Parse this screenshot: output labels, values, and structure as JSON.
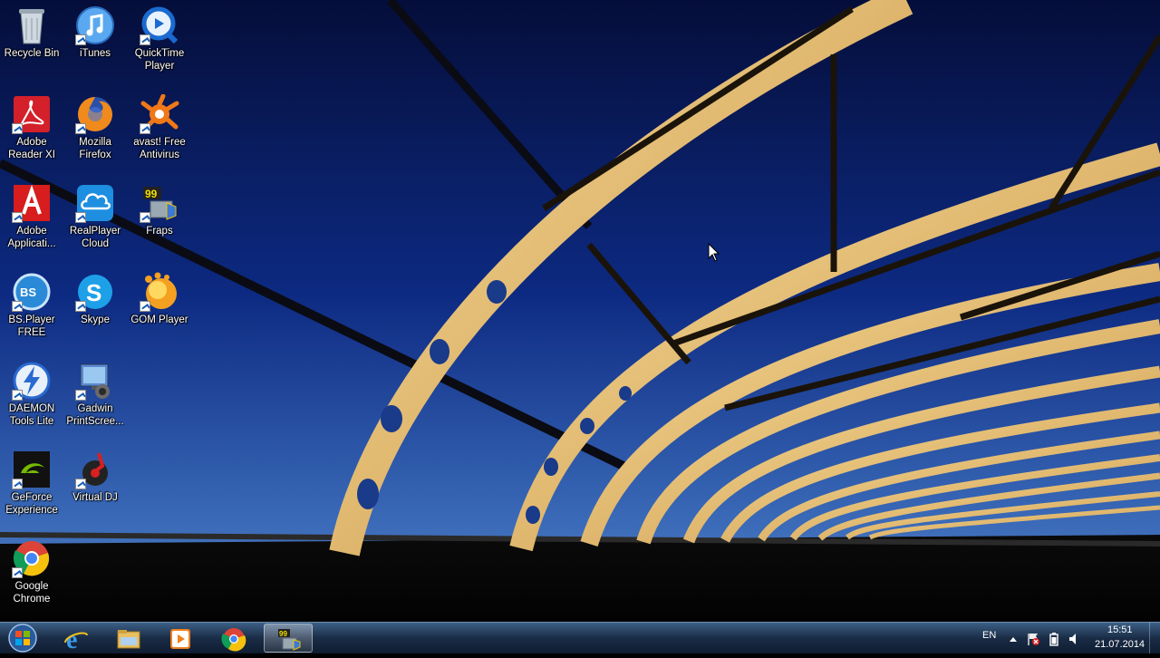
{
  "desktop": {
    "icons": [
      {
        "label": "Recycle Bin",
        "icon": "recycle-bin-icon"
      },
      {
        "label": "iTunes",
        "icon": "itunes-icon"
      },
      {
        "label": "QuickTime\nPlayer",
        "icon": "quicktime-icon"
      },
      {
        "label": "Adobe\nReader XI",
        "icon": "adobe-reader-icon"
      },
      {
        "label": "Mozilla\nFirefox",
        "icon": "firefox-icon"
      },
      {
        "label": "avast! Free\nAntivirus",
        "icon": "avast-icon"
      },
      {
        "label": "Adobe\nApplicati...",
        "icon": "adobe-application-manager-icon"
      },
      {
        "label": "RealPlayer\nCloud",
        "icon": "realplayer-cloud-icon"
      },
      {
        "label": "Fraps",
        "icon": "fraps-icon"
      },
      {
        "label": "BS.Player\nFREE",
        "icon": "bsplayer-icon"
      },
      {
        "label": "Skype",
        "icon": "skype-icon"
      },
      {
        "label": "GOM Player",
        "icon": "gom-player-icon"
      },
      {
        "label": "DAEMON\nTools Lite",
        "icon": "daemon-tools-icon"
      },
      {
        "label": "Gadwin\nPrintScree...",
        "icon": "gadwin-printscreen-icon"
      },
      {
        "label": "GeForce\nExperience",
        "icon": "geforce-experience-icon"
      },
      {
        "label": "Virtual DJ",
        "icon": "virtual-dj-icon"
      },
      {
        "label": "Google\nChrome",
        "icon": "google-chrome-icon"
      }
    ]
  },
  "taskbar": {
    "pinned": [
      {
        "icon": "internet-explorer-icon"
      },
      {
        "icon": "windows-explorer-icon"
      },
      {
        "icon": "media-player-icon"
      },
      {
        "icon": "google-chrome-icon"
      },
      {
        "icon": "fraps-icon",
        "active": true
      }
    ],
    "tray": {
      "language": "EN",
      "time": "15:51",
      "date": "21.07.2014"
    }
  },
  "colors": {
    "taskbar": "#1a2c46",
    "sky_top": "#0a1a5a",
    "sky_bottom": "#3a6ab8",
    "arch": "#e8c070"
  }
}
